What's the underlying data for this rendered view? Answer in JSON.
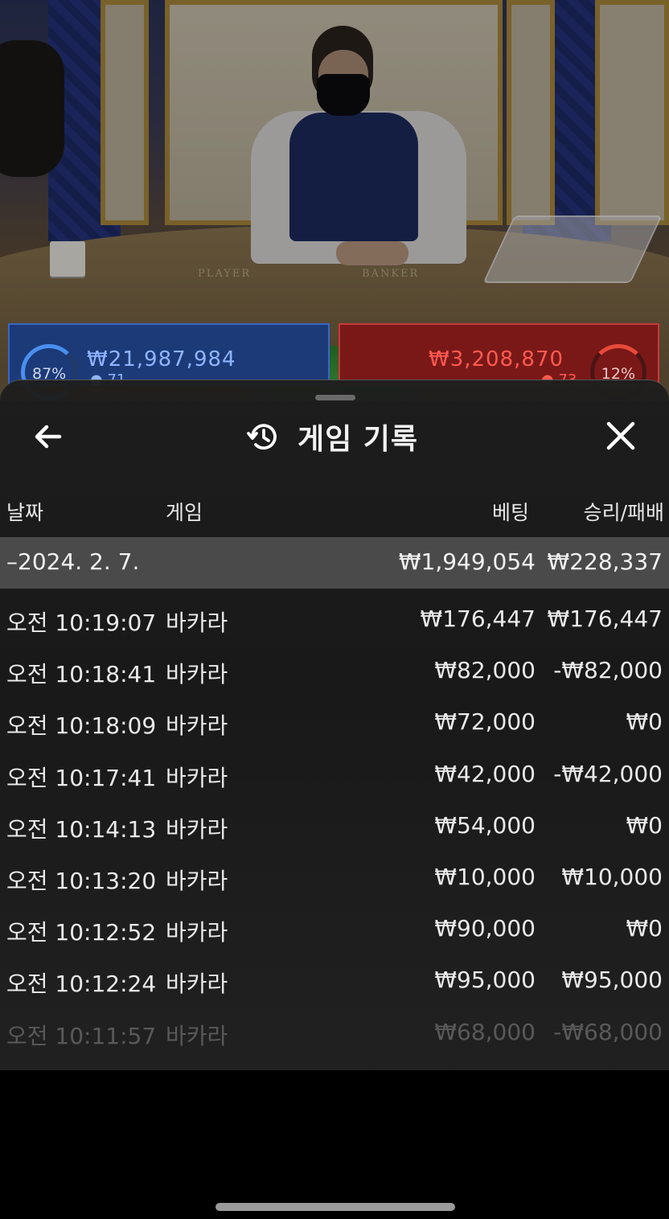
{
  "live_table": {
    "player_label": "PLAYER",
    "banker_label": "BANKER",
    "player_bar": {
      "percent": "87%",
      "amount": "₩21,987,984",
      "players": "71"
    },
    "banker_bar": {
      "percent": "12%",
      "amount": "₩3,208,870",
      "players": "73"
    }
  },
  "history": {
    "title": "게임 기록",
    "icons": {
      "back": "back-arrow-icon",
      "title": "history-clock-icon",
      "close": "close-icon"
    },
    "columns": {
      "date": "날짜",
      "game": "게임",
      "bet": "베팅",
      "result": "승리/패배"
    },
    "day": {
      "date": "–2024. 2. 7.",
      "total_bet": "₩1,949,054",
      "total_result": "₩228,337"
    },
    "rows": [
      {
        "time": "오전 10:19:07",
        "game": "바카라",
        "bet": "₩176,447",
        "result": "₩176,447"
      },
      {
        "time": "오전 10:18:41",
        "game": "바카라",
        "bet": "₩82,000",
        "result": "-₩82,000"
      },
      {
        "time": "오전 10:18:09",
        "game": "바카라",
        "bet": "₩72,000",
        "result": "₩0"
      },
      {
        "time": "오전 10:17:41",
        "game": "바카라",
        "bet": "₩42,000",
        "result": "-₩42,000"
      },
      {
        "time": "오전 10:14:13",
        "game": "바카라",
        "bet": "₩54,000",
        "result": "₩0"
      },
      {
        "time": "오전 10:13:20",
        "game": "바카라",
        "bet": "₩10,000",
        "result": "₩10,000"
      },
      {
        "time": "오전 10:12:52",
        "game": "바카라",
        "bet": "₩90,000",
        "result": "₩0"
      },
      {
        "time": "오전 10:12:24",
        "game": "바카라",
        "bet": "₩95,000",
        "result": "₩95,000"
      },
      {
        "time": "오전 10:11:57",
        "game": "바카라",
        "bet": "₩68,000",
        "result": "-₩68,000"
      }
    ]
  },
  "colors": {
    "sheet_bg": "#1e1e1e",
    "day_row_bg": "#4a4a4a",
    "player_blue": "#8fb4ff",
    "banker_red": "#ff5a50"
  }
}
